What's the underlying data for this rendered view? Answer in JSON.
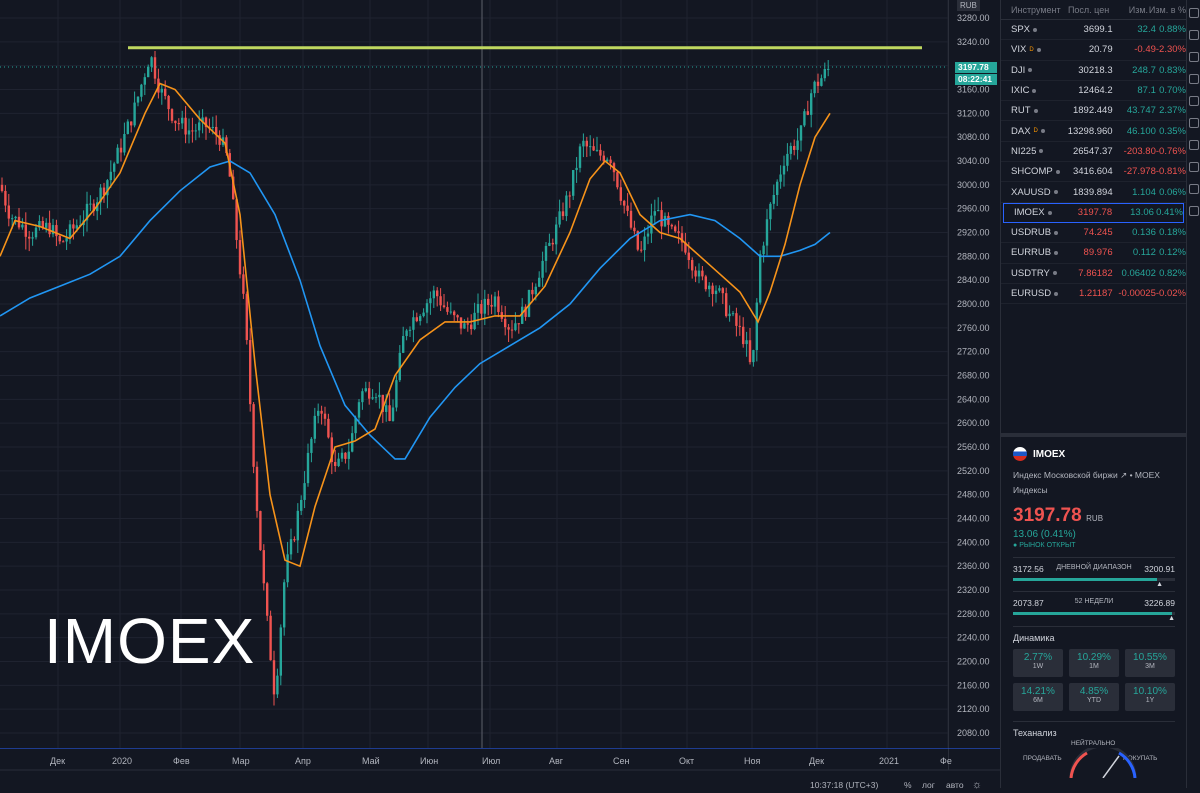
{
  "symbol_overlay": "IMOEX",
  "price_scale": {
    "currency": "RUB",
    "current_price": "3197.78",
    "countdown": "08:22:41",
    "ticks": [
      "3280.00",
      "3240.00",
      "3200.00",
      "3160.00",
      "3120.00",
      "3080.00",
      "3040.00",
      "3000.00",
      "2960.00",
      "2920.00",
      "2880.00",
      "2840.00",
      "2800.00",
      "2760.00",
      "2720.00",
      "2680.00",
      "2640.00",
      "2600.00",
      "2560.00",
      "2520.00",
      "2480.00",
      "2440.00",
      "2400.00",
      "2360.00",
      "2320.00",
      "2280.00",
      "2240.00",
      "2200.00",
      "2160.00",
      "2120.00",
      "2080.00"
    ]
  },
  "time_scale": {
    "labels": [
      "Дек",
      "2020",
      "Фев",
      "Мар",
      "Апр",
      "Май",
      "Июн",
      "Июл",
      "Авг",
      "Сен",
      "Окт",
      "Ноя",
      "Дек",
      "2021",
      "Фе"
    ],
    "clock": "10:37:18 (UTC+3)",
    "percent_btn": "%",
    "log_btn": "лог",
    "auto_btn": "авто"
  },
  "chart_data": {
    "type": "candlestick",
    "title": "",
    "ylim": [
      2060,
      3300
    ],
    "horizontal_level": 3230,
    "last_price": 3197.78,
    "series": [
      {
        "name": "",
        "color": "#f7931a",
        "kind": "ma_short"
      },
      {
        "name": "",
        "color": "#2196f3",
        "kind": "ma_long"
      }
    ]
  },
  "colors": {
    "up": "#26a69a",
    "down": "#ef5350",
    "level": "#c0d860",
    "ma_short": "#f7931a",
    "ma_long": "#2196f3"
  },
  "watchlist": {
    "headers": {
      "symbol": "Инструмент",
      "last": "Посл. цен",
      "chg": "Изм.",
      "pct": "Изм. в %"
    },
    "rows": [
      {
        "sym": "SPX",
        "flag": "",
        "last": "3699.1",
        "chg": "32.4",
        "pct": "0.88%",
        "dir": "pos"
      },
      {
        "sym": "VIX",
        "flag": "D",
        "last": "20.79",
        "chg": "-0.49",
        "pct": "-2.30%",
        "dir": "neg"
      },
      {
        "sym": "DJI",
        "flag": "",
        "last": "30218.3",
        "chg": "248.7",
        "pct": "0.83%",
        "dir": "pos"
      },
      {
        "sym": "IXIC",
        "flag": "",
        "last": "12464.2",
        "chg": "87.1",
        "pct": "0.70%",
        "dir": "pos"
      },
      {
        "sym": "RUT",
        "flag": "",
        "last": "1892.449",
        "chg": "43.747",
        "pct": "2.37%",
        "dir": "pos"
      },
      {
        "sym": "DAX",
        "flag": "D",
        "last": "13298.960",
        "chg": "46.100",
        "pct": "0.35%",
        "dir": "pos"
      },
      {
        "sym": "NI225",
        "flag": "",
        "last": "26547.37",
        "chg": "-203.80",
        "pct": "-0.76%",
        "dir": "neg"
      },
      {
        "sym": "SHCOMP",
        "flag": "",
        "last": "3416.604",
        "chg": "-27.978",
        "pct": "-0.81%",
        "dir": "neg"
      },
      {
        "sym": "XAUUSD",
        "flag": "",
        "last": "1839.894",
        "chg": "1.104",
        "pct": "0.06%",
        "dir": "pos"
      },
      {
        "sym": "IMOEX",
        "flag": "",
        "last": "3197.78",
        "chg": "13.06",
        "pct": "0.41%",
        "dir": "pos",
        "active": true
      },
      {
        "sym": "USDRUB",
        "flag": "",
        "last": "74.245",
        "chg": "0.136",
        "pct": "0.18%",
        "dir": "pos"
      },
      {
        "sym": "EURRUB",
        "flag": "",
        "last": "89.976",
        "chg": "0.112",
        "pct": "0.12%",
        "dir": "pos"
      },
      {
        "sym": "USDTRY",
        "flag": "",
        "last": "7.86182",
        "chg": "0.06402",
        "pct": "0.82%",
        "dir": "pos"
      },
      {
        "sym": "EURUSD",
        "flag": "",
        "last": "1.21187",
        "chg": "-0.00025",
        "pct": "-0.02%",
        "dir": "neg"
      }
    ]
  },
  "details": {
    "symbol": "IMOEX",
    "description": "Индекс Московской биржи",
    "exchange": "MOEX",
    "category": "Индексы",
    "price": "3197.78",
    "currency": "RUB",
    "change": "13.06 (0.41%)",
    "market_status": "РЫНОК ОТКРЫТ",
    "day_low": "3172.56",
    "day_label": "ДНЕВНОЙ ДИАПАЗОН",
    "day_high": "3200.91",
    "day_fill": 0.89,
    "y_low": "2073.87",
    "y_label": "52 НЕДЕЛИ",
    "y_high": "3226.89",
    "y_fill": 0.98,
    "dynamics_title": "Динамика",
    "dynamics": [
      {
        "v": "2.77%",
        "l": "1W"
      },
      {
        "v": "10.29%",
        "l": "1M"
      },
      {
        "v": "10.55%",
        "l": "3M"
      },
      {
        "v": "14.21%",
        "l": "6M"
      },
      {
        "v": "4.85%",
        "l": "YTD"
      },
      {
        "v": "10.10%",
        "l": "1Y"
      }
    ],
    "tech_title": "Теханализ",
    "tech_neutral": "НЕЙТРАЛЬНО",
    "tech_sell": "ПРОДАВАТЬ",
    "tech_buy": "ПОКУПАТЬ"
  }
}
